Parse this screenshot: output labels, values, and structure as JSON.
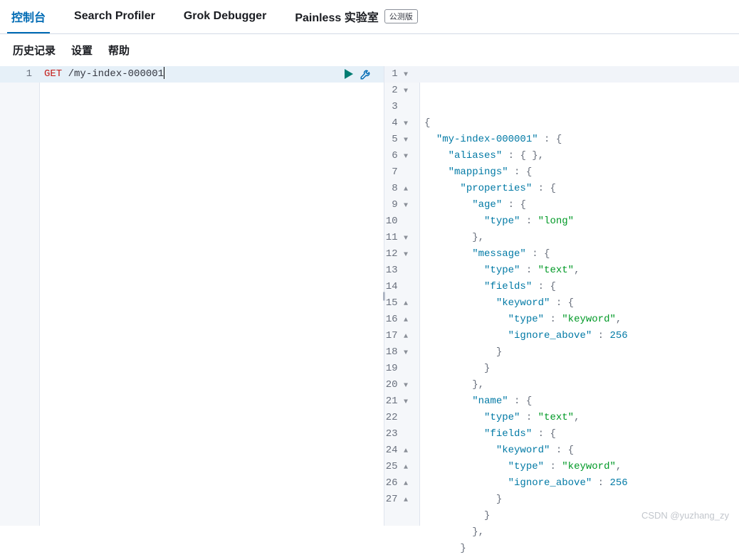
{
  "tabs": [
    {
      "label": "控制台",
      "active": true
    },
    {
      "label": "Search Profiler",
      "active": false
    },
    {
      "label": "Grok Debugger",
      "active": false
    },
    {
      "label": "Painless 实验室",
      "active": false,
      "badge": "公测版"
    }
  ],
  "subnav": {
    "history": "历史记录",
    "settings": "设置",
    "help": "帮助"
  },
  "request": {
    "line_number": "1",
    "method": "GET",
    "path": "/my-index-000001"
  },
  "response_lines": [
    {
      "n": "1",
      "fold": "down",
      "txt": [
        {
          "t": "punc",
          "v": "{"
        }
      ]
    },
    {
      "n": "2",
      "fold": "down",
      "ind": 2,
      "txt": [
        {
          "t": "key",
          "v": "\"my-index-000001\""
        },
        {
          "t": "punc",
          "v": " : {"
        }
      ]
    },
    {
      "n": "3",
      "fold": "",
      "ind": 4,
      "txt": [
        {
          "t": "key",
          "v": "\"aliases\""
        },
        {
          "t": "punc",
          "v": " : { },"
        }
      ]
    },
    {
      "n": "4",
      "fold": "down",
      "ind": 4,
      "txt": [
        {
          "t": "key",
          "v": "\"mappings\""
        },
        {
          "t": "punc",
          "v": " : {"
        }
      ]
    },
    {
      "n": "5",
      "fold": "down",
      "ind": 6,
      "txt": [
        {
          "t": "key",
          "v": "\"properties\""
        },
        {
          "t": "punc",
          "v": " : {"
        }
      ]
    },
    {
      "n": "6",
      "fold": "down",
      "ind": 8,
      "txt": [
        {
          "t": "key",
          "v": "\"age\""
        },
        {
          "t": "punc",
          "v": " : {"
        }
      ]
    },
    {
      "n": "7",
      "fold": "",
      "ind": 10,
      "txt": [
        {
          "t": "key",
          "v": "\"type\""
        },
        {
          "t": "punc",
          "v": " : "
        },
        {
          "t": "str",
          "v": "\"long\""
        }
      ]
    },
    {
      "n": "8",
      "fold": "up",
      "ind": 8,
      "txt": [
        {
          "t": "punc",
          "v": "},"
        }
      ]
    },
    {
      "n": "9",
      "fold": "down",
      "ind": 8,
      "txt": [
        {
          "t": "key",
          "v": "\"message\""
        },
        {
          "t": "punc",
          "v": " : {"
        }
      ]
    },
    {
      "n": "10",
      "fold": "",
      "ind": 10,
      "txt": [
        {
          "t": "key",
          "v": "\"type\""
        },
        {
          "t": "punc",
          "v": " : "
        },
        {
          "t": "str",
          "v": "\"text\""
        },
        {
          "t": "punc",
          "v": ","
        }
      ]
    },
    {
      "n": "11",
      "fold": "down",
      "ind": 10,
      "txt": [
        {
          "t": "key",
          "v": "\"fields\""
        },
        {
          "t": "punc",
          "v": " : {"
        }
      ]
    },
    {
      "n": "12",
      "fold": "down",
      "ind": 12,
      "txt": [
        {
          "t": "key",
          "v": "\"keyword\""
        },
        {
          "t": "punc",
          "v": " : {"
        }
      ]
    },
    {
      "n": "13",
      "fold": "",
      "ind": 14,
      "txt": [
        {
          "t": "key",
          "v": "\"type\""
        },
        {
          "t": "punc",
          "v": " : "
        },
        {
          "t": "str",
          "v": "\"keyword\""
        },
        {
          "t": "punc",
          "v": ","
        }
      ]
    },
    {
      "n": "14",
      "fold": "",
      "ind": 14,
      "txt": [
        {
          "t": "key",
          "v": "\"ignore_above\""
        },
        {
          "t": "punc",
          "v": " : "
        },
        {
          "t": "num",
          "v": "256"
        }
      ]
    },
    {
      "n": "15",
      "fold": "up",
      "ind": 12,
      "txt": [
        {
          "t": "punc",
          "v": "}"
        }
      ]
    },
    {
      "n": "16",
      "fold": "up",
      "ind": 10,
      "txt": [
        {
          "t": "punc",
          "v": "}"
        }
      ]
    },
    {
      "n": "17",
      "fold": "up",
      "ind": 8,
      "txt": [
        {
          "t": "punc",
          "v": "},"
        }
      ]
    },
    {
      "n": "18",
      "fold": "down",
      "ind": 8,
      "txt": [
        {
          "t": "key",
          "v": "\"name\""
        },
        {
          "t": "punc",
          "v": " : {"
        }
      ]
    },
    {
      "n": "19",
      "fold": "",
      "ind": 10,
      "txt": [
        {
          "t": "key",
          "v": "\"type\""
        },
        {
          "t": "punc",
          "v": " : "
        },
        {
          "t": "str",
          "v": "\"text\""
        },
        {
          "t": "punc",
          "v": ","
        }
      ]
    },
    {
      "n": "20",
      "fold": "down",
      "ind": 10,
      "txt": [
        {
          "t": "key",
          "v": "\"fields\""
        },
        {
          "t": "punc",
          "v": " : {"
        }
      ]
    },
    {
      "n": "21",
      "fold": "down",
      "ind": 12,
      "txt": [
        {
          "t": "key",
          "v": "\"keyword\""
        },
        {
          "t": "punc",
          "v": " : {"
        }
      ]
    },
    {
      "n": "22",
      "fold": "",
      "ind": 14,
      "txt": [
        {
          "t": "key",
          "v": "\"type\""
        },
        {
          "t": "punc",
          "v": " : "
        },
        {
          "t": "str",
          "v": "\"keyword\""
        },
        {
          "t": "punc",
          "v": ","
        }
      ]
    },
    {
      "n": "23",
      "fold": "",
      "ind": 14,
      "txt": [
        {
          "t": "key",
          "v": "\"ignore_above\""
        },
        {
          "t": "punc",
          "v": " : "
        },
        {
          "t": "num",
          "v": "256"
        }
      ]
    },
    {
      "n": "24",
      "fold": "up",
      "ind": 12,
      "txt": [
        {
          "t": "punc",
          "v": "}"
        }
      ]
    },
    {
      "n": "25",
      "fold": "up",
      "ind": 10,
      "txt": [
        {
          "t": "punc",
          "v": "}"
        }
      ]
    },
    {
      "n": "26",
      "fold": "up",
      "ind": 8,
      "txt": [
        {
          "t": "punc",
          "v": "},"
        }
      ]
    },
    {
      "n": "27",
      "fold": "up",
      "ind": 6,
      "txt": [
        {
          "t": "punc",
          "v": "}"
        }
      ]
    }
  ],
  "watermark": "CSDN @yuzhang_zy"
}
